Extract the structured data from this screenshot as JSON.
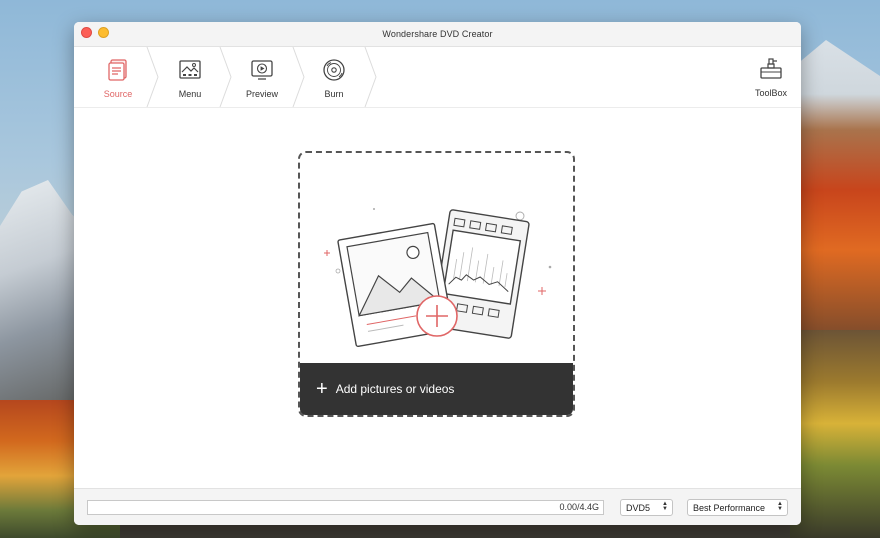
{
  "window": {
    "title": "Wondershare DVD Creator"
  },
  "steps": [
    {
      "label": "Source",
      "icon": "source-icon",
      "active": true
    },
    {
      "label": "Menu",
      "icon": "menu-image-icon",
      "active": false
    },
    {
      "label": "Preview",
      "icon": "preview-play-icon",
      "active": false
    },
    {
      "label": "Burn",
      "icon": "burn-disc-icon",
      "active": false
    }
  ],
  "toolbox": {
    "label": "ToolBox",
    "icon": "toolbox-icon"
  },
  "dropzone": {
    "add_label": "Add pictures or videos",
    "icon": "plus-icon"
  },
  "status": {
    "size": "0.00/4.4G",
    "progress": 0,
    "disc_type": "DVD5",
    "quality": "Best Performance"
  },
  "colors": {
    "accent": "#e06666",
    "dark_bar": "#333333"
  }
}
